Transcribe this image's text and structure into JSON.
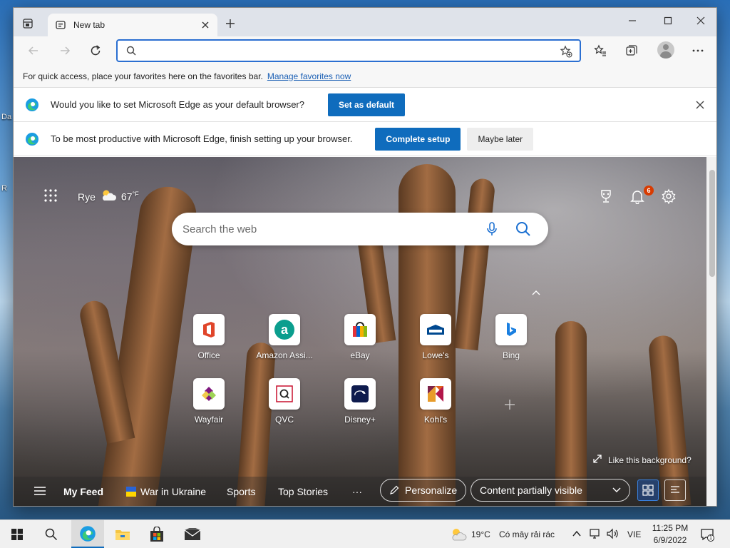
{
  "desktop": {
    "label_1": "Da",
    "label_2": "R"
  },
  "browser": {
    "tab": {
      "title": "New tab"
    },
    "address_bar": {
      "value": "",
      "placeholder": ""
    },
    "favorites_bar": {
      "text": "For quick access, place your favorites here on the favorites bar.",
      "link": "Manage favorites now"
    },
    "infobar_default": {
      "text": "Would you like to set Microsoft Edge as your default browser?",
      "button": "Set as default"
    },
    "infobar_setup": {
      "text": "To be most productive with Microsoft Edge, finish setting up your browser.",
      "primary_button": "Complete setup",
      "secondary_button": "Maybe later"
    }
  },
  "ntp": {
    "weather": {
      "city": "Rye",
      "temp": "67",
      "unit": "°F"
    },
    "notification_count": "6",
    "search": {
      "placeholder": "Search the web"
    },
    "tiles": [
      {
        "label": "Office"
      },
      {
        "label": "Amazon Assi..."
      },
      {
        "label": "eBay"
      },
      {
        "label": "Lowe's"
      },
      {
        "label": "Bing"
      },
      {
        "label": "Wayfair"
      },
      {
        "label": "QVC"
      },
      {
        "label": "Disney+"
      },
      {
        "label": "Kohl's"
      }
    ],
    "like_background": "Like this background?",
    "feed": {
      "my_feed": "My Feed",
      "war_in_ukraine": "War in Ukraine",
      "sports": "Sports",
      "top_stories": "Top Stories",
      "more": "···",
      "personalize": "Personalize",
      "content_visibility": "Content partially visible"
    }
  },
  "taskbar": {
    "weather": {
      "temp": "19°C",
      "condition": "Có mây rải rác"
    },
    "language": "VIE",
    "time": "11:25 PM",
    "date": "6/9/2022",
    "notification_count": "1"
  },
  "colors": {
    "accent": "#0f6cbd",
    "omnibox_border": "#2b6fd1",
    "badge": "#d83b01"
  }
}
